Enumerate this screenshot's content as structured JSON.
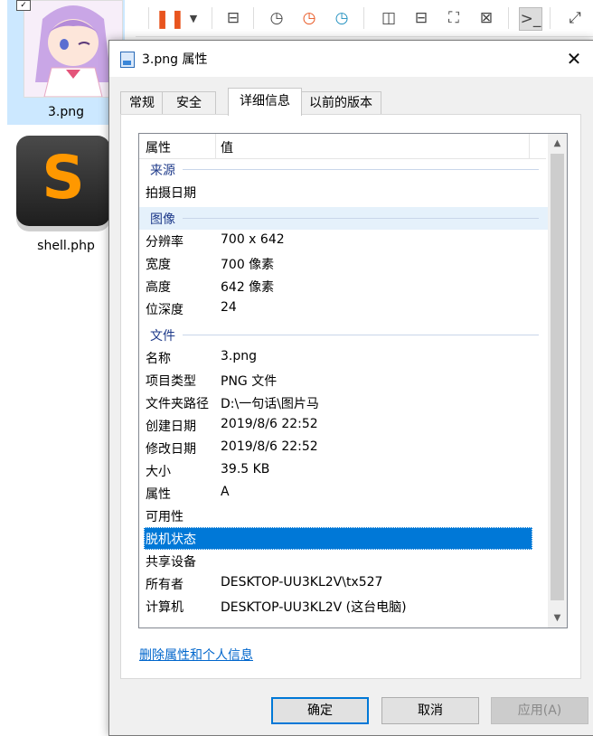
{
  "explorer": {
    "files": [
      {
        "name": "3.png"
      },
      {
        "name": "shell.php"
      }
    ],
    "toolbar_icons": [
      "pause-icon",
      "dropdown-icon",
      "network-icon",
      "history-icon",
      "restore-icon",
      "download-icon",
      "split-vertical-icon",
      "split-horizontal-icon",
      "fit-icon",
      "no-fit-icon",
      "terminal-icon",
      "expand-icon"
    ],
    "sublime_glyph": "S"
  },
  "dialog": {
    "title": "3.png 属性",
    "close_glyph": "✕",
    "tabs": [
      {
        "label": "常规"
      },
      {
        "label": "安全"
      },
      {
        "label": "详细信息"
      },
      {
        "label": "以前的版本"
      }
    ],
    "list": {
      "header": {
        "property": "属性",
        "value": "值"
      },
      "groups": {
        "source": "来源",
        "image": "图像",
        "file": "文件"
      },
      "rows": {
        "shot_date": {
          "k": "拍摄日期",
          "v": ""
        },
        "resolution": {
          "k": "分辨率",
          "v": "700 x 642"
        },
        "width": {
          "k": "宽度",
          "v": "700 像素"
        },
        "height": {
          "k": "高度",
          "v": "642 像素"
        },
        "bit_depth": {
          "k": "位深度",
          "v": "24"
        },
        "name": {
          "k": "名称",
          "v": "3.png"
        },
        "item_type": {
          "k": "项目类型",
          "v": "PNG 文件"
        },
        "folder_path": {
          "k": "文件夹路径",
          "v": "D:\\一句话\\图片马"
        },
        "created": {
          "k": "创建日期",
          "v": "2019/8/6 22:52"
        },
        "modified": {
          "k": "修改日期",
          "v": "2019/8/6 22:52"
        },
        "size": {
          "k": "大小",
          "v": "39.5 KB"
        },
        "attributes": {
          "k": "属性",
          "v": "A"
        },
        "availability": {
          "k": "可用性",
          "v": ""
        },
        "offline_status": {
          "k": "脱机状态",
          "v": ""
        },
        "shared_with": {
          "k": "共享设备",
          "v": ""
        },
        "owner": {
          "k": "所有者",
          "v": "DESKTOP-UU3KL2V\\tx527"
        },
        "computer": {
          "k": "计算机",
          "v": "DESKTOP-UU3KL2V (这台电脑)"
        }
      }
    },
    "remove_link": "删除属性和个人信息",
    "buttons": {
      "ok": "确定",
      "cancel": "取消",
      "apply": "应用(A)"
    }
  },
  "colors": {
    "selection": "#0078d7",
    "link": "#0066cc",
    "group_text": "#1e3a8a",
    "pause": "#e8541e",
    "sublime": "#ff9800"
  }
}
